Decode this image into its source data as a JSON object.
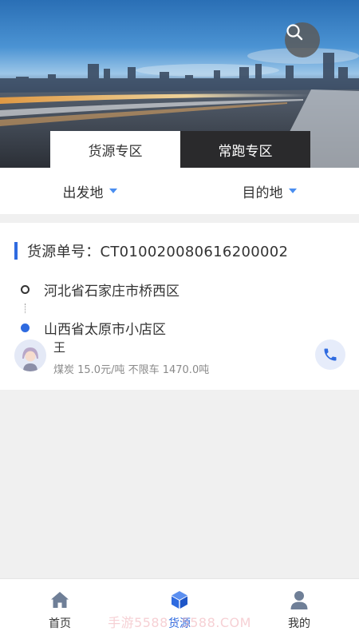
{
  "banner": {
    "tabs": [
      {
        "label": "货源专区",
        "active": true
      },
      {
        "label": "常跑专区",
        "active": false
      }
    ]
  },
  "filters": {
    "departure_label": "出发地",
    "destination_label": "目的地"
  },
  "card": {
    "order_label": "货源单号：CT01002008061620000​2",
    "origin": "河北省石家庄市桥西区",
    "destination": "山西省太原市小店区",
    "shipper_name": "王",
    "cargo_info": "煤炭 15.0元/吨 不限车 1470.0吨"
  },
  "nav": {
    "items": [
      {
        "label": "首页",
        "icon": "home-icon",
        "active": false
      },
      {
        "label": "货源",
        "icon": "cube-icon",
        "active": true
      },
      {
        "label": "我的",
        "icon": "user-icon",
        "active": false
      }
    ]
  },
  "watermark": "手游5588 · 5588.COM",
  "colors": {
    "accent": "#2f6be0",
    "tab_inactive_bg": "#2a2a2c",
    "caret": "#4a8ef0"
  }
}
